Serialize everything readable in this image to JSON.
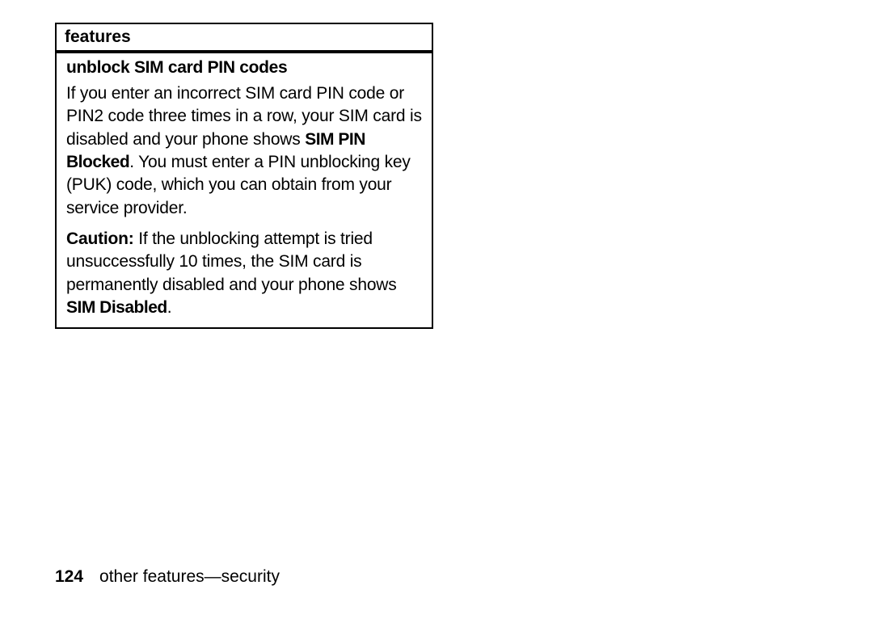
{
  "box": {
    "header": "features",
    "section_title": "unblock SIM card PIN codes",
    "para1_a": "If you enter an incorrect SIM card PIN code or PIN2 code three times in a row, your SIM card is disabled and your phone shows ",
    "para1_bold": "SIM PIN Blocked",
    "para1_b": ". You must enter a PIN unblocking key (PUK) code, which you can obtain from your service provider.",
    "para2_caution": "Caution:",
    "para2_a": " If the unblocking attempt is tried unsuccessfully 10 times, the SIM card is permanently disabled and your phone shows ",
    "para2_bold": "SIM Disabled",
    "para2_b": "."
  },
  "footer": {
    "page_number": "124",
    "section": "other features—security"
  }
}
